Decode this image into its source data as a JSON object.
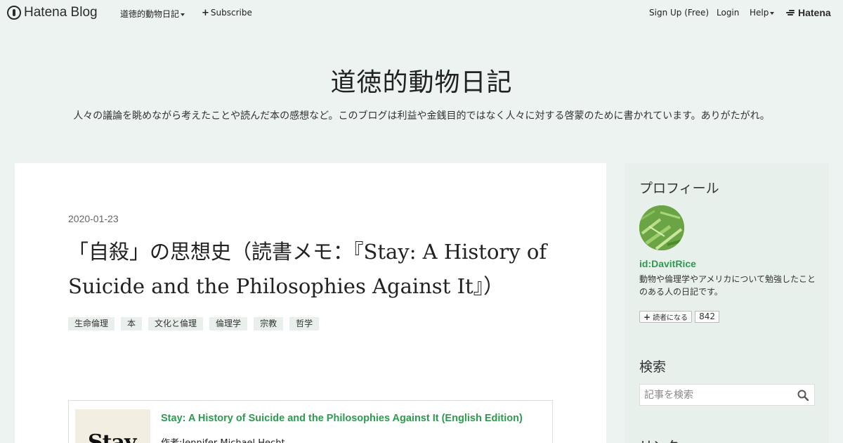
{
  "global_header": {
    "logo": "Hatena Blog",
    "blog_menu": "道徳的動物日記",
    "subscribe": "Subscribe",
    "signup": "Sign Up (Free)",
    "login": "Login",
    "help": "Help",
    "hatena": "Hatena"
  },
  "blog": {
    "title": "道徳的動物日記",
    "description": "人々の議論を眺めながら考えたことや読んだ本の感想など。このブログは利益や金銭目的ではなく人々に対する啓蒙のために書かれています。ありがたがれ。"
  },
  "entry": {
    "date": "2020-01-23",
    "title": "「自殺」の思想史（読書メモ：『Stay: A History of Suicide and the Philosophies Against It』）",
    "categories": [
      "生命倫理",
      "本",
      "文化と倫理",
      "倫理学",
      "宗教",
      "哲学"
    ],
    "embed": {
      "title": "Stay: A History of Suicide and the Philosophies Against It (English Edition)",
      "author": "作者:Jennifer Michael Hecht",
      "thumb_text": "Stay"
    }
  },
  "sidebar": {
    "profile": {
      "heading": "プロフィール",
      "id": "id:DavitRice",
      "description": "動物や倫理学やアメリカについて勉強したことのある人の日記です。",
      "reader_button": "読者になる",
      "reader_count": "842"
    },
    "search": {
      "heading": "検索",
      "placeholder": "記事を検索"
    },
    "links_heading": "リンク"
  },
  "colors": {
    "background": "#ecf3f0",
    "accent_green": "#2e9a4f",
    "card": "#ffffff"
  }
}
